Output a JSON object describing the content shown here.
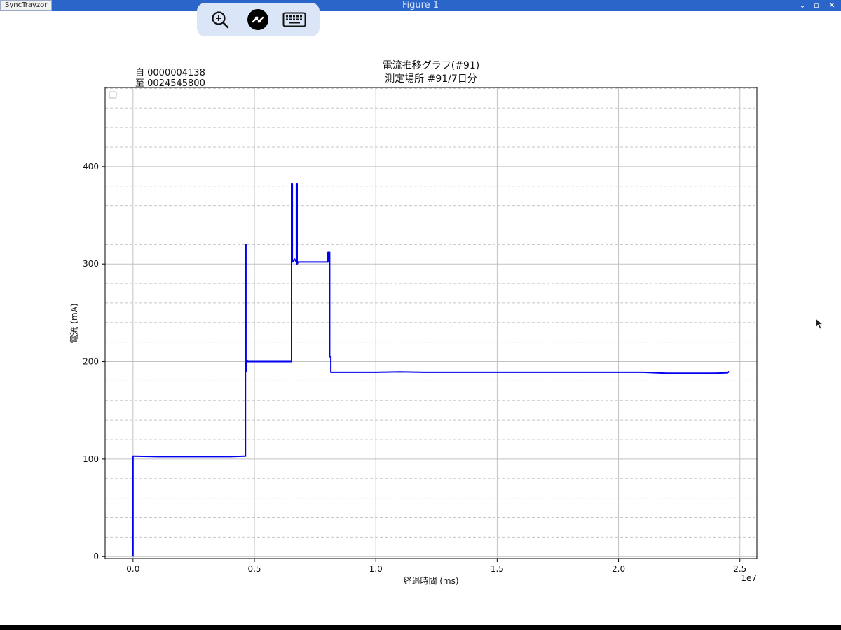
{
  "window": {
    "app_tab": "SyncTrayzor",
    "title": "Figure 1",
    "controls": [
      "chevron-down-icon",
      "maximize-icon",
      "close-icon"
    ]
  },
  "toolbar": {
    "items": [
      "zoom-in-icon",
      "remote-connection-icon",
      "keyboard-icon"
    ]
  },
  "colors": {
    "titlebar": "#2a66c9",
    "toolbar_bg": "#dbe5f8",
    "series": "#0000ee"
  },
  "chart_data": {
    "type": "line",
    "title_line1": "電流推移グラフ(#91)",
    "title_line2": "測定場所 #91/7日分",
    "range_from": "自 0000004138",
    "range_to": "至 0024545800",
    "xlabel": "経過時間 (ms)",
    "ylabel": "電流 (mA)",
    "x_offset_label": "1e7",
    "xlim": [
      -0.115,
      2.57
    ],
    "ylim": [
      -2,
      481
    ],
    "xticks": [
      0.0,
      0.5,
      1.0,
      1.5,
      2.0,
      2.5
    ],
    "xtick_labels": [
      "0.0",
      "0.5",
      "1.0",
      "1.5",
      "2.0",
      "2.5"
    ],
    "yticks": [
      0,
      100,
      200,
      300,
      400
    ],
    "ytick_labels": [
      "0",
      "100",
      "200",
      "300",
      "400"
    ],
    "y_minor_step": 20,
    "grid": true,
    "legend": "top-left",
    "series": [
      {
        "x": [
          0.0,
          0.0,
          0.003,
          0.1,
          0.2,
          0.3,
          0.4,
          0.46,
          0.463,
          0.463,
          0.465,
          0.465,
          0.467,
          0.467,
          0.47,
          0.47,
          0.48,
          0.5,
          0.55,
          0.6,
          0.65,
          0.653,
          0.653,
          0.656,
          0.656,
          0.66,
          0.665,
          0.67,
          0.673,
          0.673,
          0.676,
          0.676,
          0.68,
          0.69,
          0.7,
          0.75,
          0.8,
          0.803,
          0.803,
          0.81,
          0.81,
          0.815,
          0.815,
          0.83,
          0.9,
          1.0,
          1.1,
          1.2,
          1.3,
          1.4,
          1.5,
          1.6,
          1.7,
          1.8,
          1.9,
          2.0,
          2.1,
          2.15,
          2.2,
          2.3,
          2.4,
          2.45,
          2.455
        ],
        "y": [
          0,
          103,
          103,
          102.5,
          102.5,
          102.5,
          102.5,
          103,
          103,
          320,
          320,
          190,
          190,
          201,
          201,
          200,
          200,
          200,
          200,
          200,
          200,
          200,
          382,
          382,
          302,
          303,
          305,
          303,
          303,
          382,
          382,
          300,
          302,
          302,
          302,
          302,
          302,
          302,
          312,
          312,
          205,
          205,
          189,
          189,
          189,
          189,
          189.5,
          189,
          189,
          189,
          189,
          189,
          189,
          189,
          189,
          189,
          189,
          188.5,
          188,
          188,
          188,
          188.5,
          190
        ]
      }
    ]
  }
}
